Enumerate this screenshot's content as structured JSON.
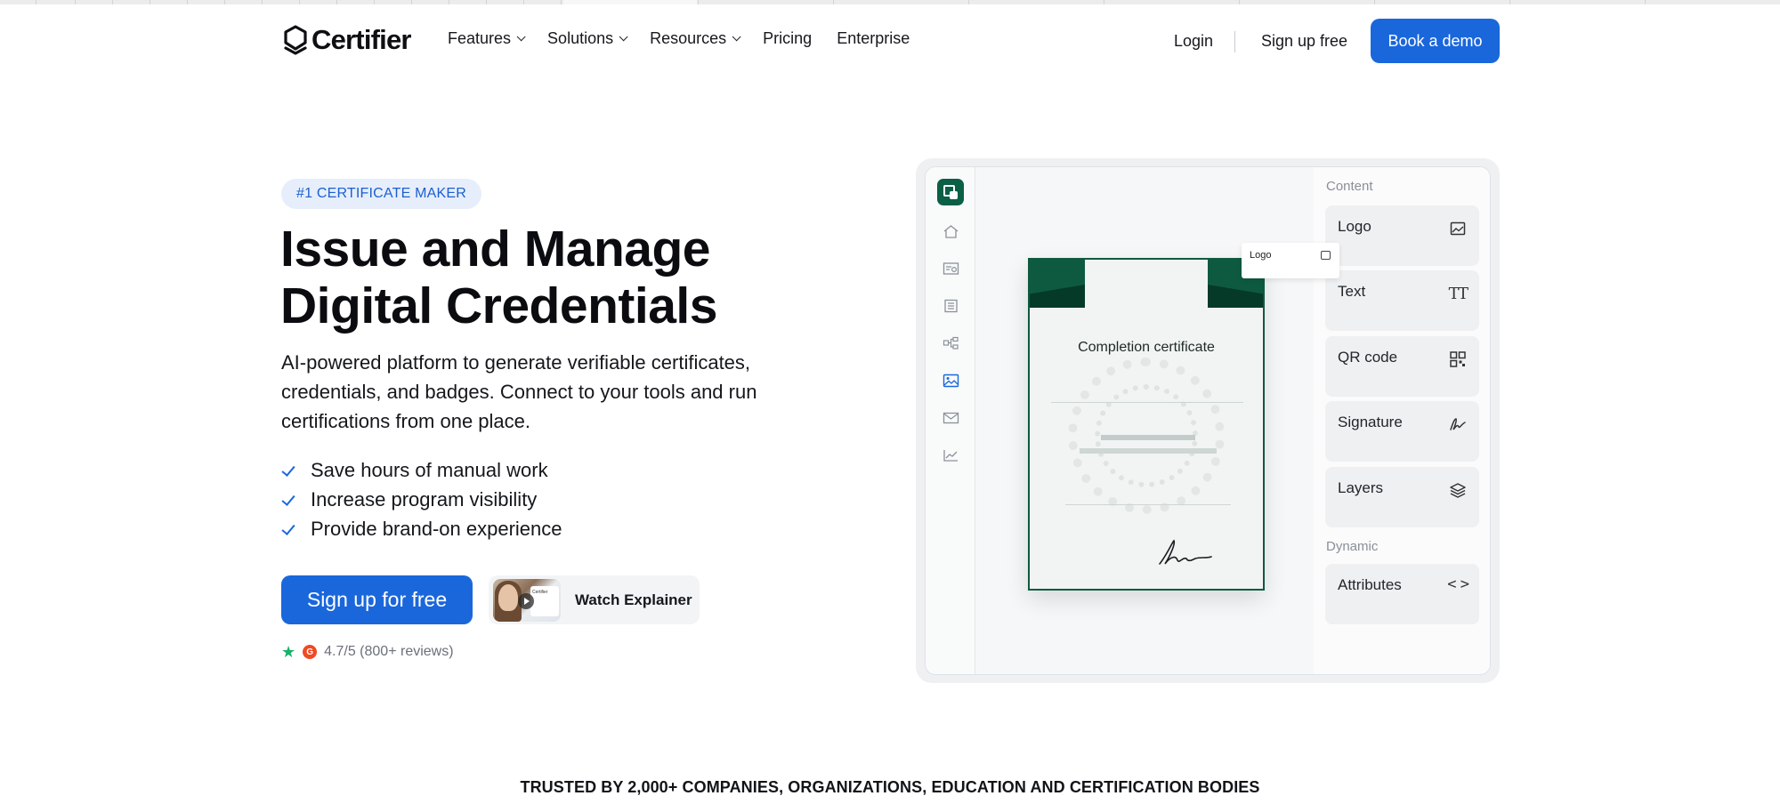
{
  "nav": {
    "brand": "Certifier",
    "menu": [
      {
        "label": "Features",
        "has_dropdown": true
      },
      {
        "label": "Solutions",
        "has_dropdown": true
      },
      {
        "label": "Resources",
        "has_dropdown": true
      },
      {
        "label": "Pricing",
        "has_dropdown": false
      },
      {
        "label": "Enterprise",
        "has_dropdown": false
      }
    ],
    "login": "Login",
    "signup": "Sign up free",
    "demo": "Book a demo"
  },
  "hero": {
    "badge": "#1 CERTIFICATE MAKER",
    "title_line1": "Issue and Manage",
    "title_line2": "Digital Credentials",
    "subtitle": "AI-powered platform to generate verifiable certificates, credentials, and badges. Connect to your tools and run certifications from one place.",
    "benefits": [
      "Save hours of manual work",
      "Increase program visibility",
      "Provide brand-on experience"
    ],
    "cta": "Sign up for free",
    "watch": "Watch Explainer",
    "thumb_caption": "Certifier",
    "rating": "4.7/5 (800+ reviews)",
    "rating_badge": "G"
  },
  "editor": {
    "certificate_title": "Completion certificate",
    "floating_label": "Logo",
    "content_section": "Content",
    "dynamic_section": "Dynamic",
    "content_items": [
      "Logo",
      "Text",
      "QR code",
      "Signature",
      "Layers"
    ],
    "dynamic_items": [
      "Attributes"
    ],
    "text_icon_glyph": "TT",
    "code_icon_glyph": "< >"
  },
  "trusted": "TRUSTED BY 2,000+ COMPANIES, ORGANIZATIONS, EDUCATION AND CERTIFICATION BODIES",
  "colors": {
    "primary": "#1a67dc",
    "brand_green": "#0e5a40",
    "badge_bg": "#e6eefb"
  }
}
